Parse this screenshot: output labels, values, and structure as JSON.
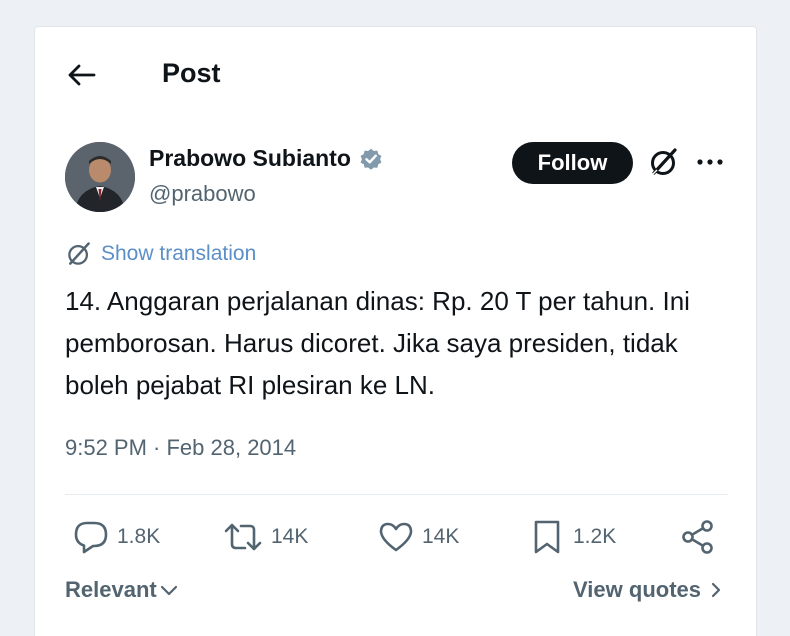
{
  "header": {
    "title": "Post",
    "back_icon": "arrow-left-icon"
  },
  "author": {
    "name": "Prabowo Subianto",
    "handle": "@prabowo",
    "verified": true,
    "verified_color": "#829aab"
  },
  "buttons": {
    "follow_label": "Follow",
    "grok_icon": "grok-icon",
    "more_icon": "more-horizontal-icon"
  },
  "translation": {
    "label": "Show translation",
    "color": "#5b8fc7"
  },
  "tweet": {
    "text": "14. Anggaran perjalanan dinas: Rp. 20 T per tahun. Ini pemborosan. Harus dicoret. Jika saya presiden, tidak boleh pejabat RI plesiran ke LN.",
    "timestamp": "9:52 PM · Feb 28, 2014"
  },
  "actions": {
    "replies": "1.8K",
    "reposts": "14K",
    "likes": "14K",
    "bookmarks": "1.2K"
  },
  "footer": {
    "sort_label": "Relevant",
    "quotes_label": "View quotes"
  },
  "colors": {
    "text_primary": "#0f1419",
    "text_secondary": "#536471",
    "background": "#edf0f5"
  }
}
